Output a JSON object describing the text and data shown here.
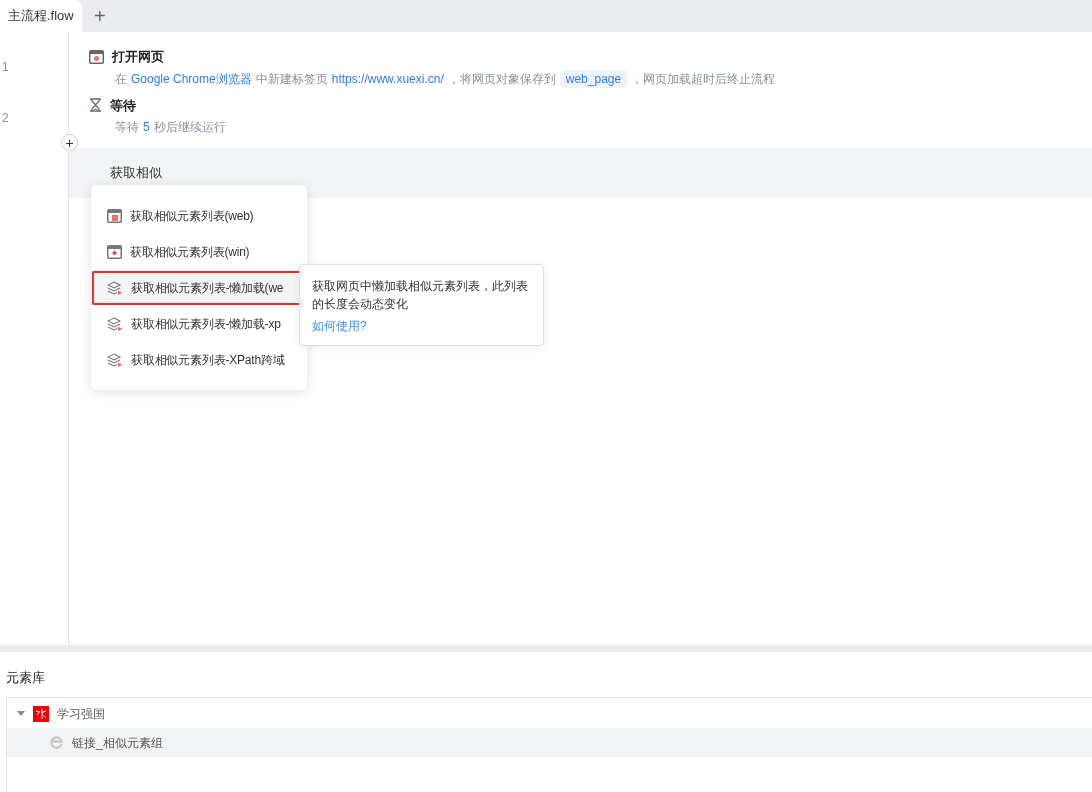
{
  "tabs": [
    {
      "label": "主流程.flow",
      "selected": true
    }
  ],
  "add_tab": "+",
  "line_numbers": [
    "1",
    "2"
  ],
  "steps": [
    {
      "kind": "open-web",
      "title": "打开网页",
      "description": [
        {
          "kind": "plain",
          "text": "在"
        },
        {
          "kind": "value",
          "text": "Google Chrome浏览器"
        },
        {
          "kind": "plain",
          "text": "中新建标签页"
        },
        {
          "kind": "value",
          "text": "https://www.xuexi.cn/"
        },
        {
          "kind": "plain",
          "text": "，将网页对象保存到"
        },
        {
          "kind": "variable",
          "text": "web_page"
        },
        {
          "kind": "plain",
          "text": "，网页加载超时后终止流程"
        }
      ]
    },
    {
      "kind": "wait",
      "title": "等待",
      "description": [
        {
          "kind": "plain",
          "text": "等待"
        },
        {
          "kind": "value",
          "text": "5"
        },
        {
          "kind": "plain",
          "text": "秒后继续运行"
        }
      ]
    }
  ],
  "search": {
    "value": "获取相似"
  },
  "menu": [
    {
      "label": "获取相似元素列表(web)",
      "kind": "web",
      "selected": false,
      "outlined": false
    },
    {
      "label": "获取相似元素列表(win)",
      "kind": "win",
      "selected": false,
      "outlined": false
    },
    {
      "label": "获取相似元素列表-懒加载(we",
      "kind": "layers",
      "selected": true,
      "outlined": true
    },
    {
      "label": "获取相似元素列表-懒加载-xp",
      "kind": "layers",
      "selected": false,
      "outlined": false
    },
    {
      "label": "获取相似元素列表-XPath跨域",
      "kind": "layers",
      "selected": false,
      "outlined": false
    }
  ],
  "tooltip": {
    "text": "获取网页中懒加载相似元素列表，此列表的长度会动态变化",
    "link": "如何使用?"
  },
  "element_library": {
    "title": "元素库",
    "tree": [
      {
        "label": "学习强国",
        "kind": "site",
        "expanded": true,
        "selected": false,
        "children": [
          {
            "label": "链接_相似元素组",
            "kind": "link",
            "selected": true
          }
        ]
      }
    ]
  }
}
